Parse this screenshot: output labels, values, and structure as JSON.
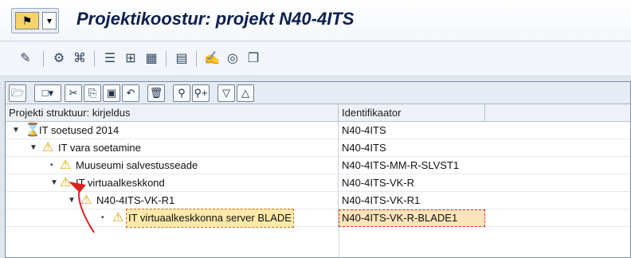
{
  "window": {
    "title": "Projektikoostur: projekt N40-4ITS",
    "system_menu_icon": "sap-menu-icon",
    "dropdown_icon": "chevron-down-icon"
  },
  "toolbar1": {
    "icons": [
      "wand-icon",
      "org-icon",
      "hierarchy-icon",
      "list-icon",
      "tree-icon",
      "grid-icon",
      "table-icon",
      "edit-icon",
      "cycle-icon",
      "notes-icon"
    ]
  },
  "toolbar2": {
    "icons": [
      "open-folder-icon",
      "new-doc-icon",
      "cut-icon",
      "copy-icon",
      "paste-icon",
      "undo-icon",
      "delete-icon",
      "find-icon",
      "find-next-icon",
      "expand-icon",
      "collapse-icon"
    ]
  },
  "table": {
    "headers": [
      "Projekti struktuur: kirjeldus",
      "Identifikaator"
    ],
    "rows": [
      {
        "desc": "IT soetused 2014",
        "id": "N40-4ITS",
        "level": 0,
        "icon": "project-icon",
        "expander": "▼"
      },
      {
        "desc": "IT vara soetamine",
        "id": "N40-4ITS",
        "level": 1,
        "icon": "warning-icon",
        "expander": "▼"
      },
      {
        "desc": "Muuseumi salvestusseade",
        "id": "N40-4ITS-MM-R-SLVST1",
        "level": 2,
        "icon": "warning-icon",
        "expander": "•"
      },
      {
        "desc": "IT virtuaalkeskkond",
        "id": "N40-4ITS-VK-R",
        "level": 2,
        "icon": "warning-icon",
        "expander": "▼"
      },
      {
        "desc": "N40-4ITS-VK-R1",
        "id": "N40-4ITS-VK-R1",
        "level": 3,
        "icon": "warning-icon",
        "expander": "▼"
      },
      {
        "desc": "IT virtuaalkeskkonna server BLADE",
        "id": "N40-4ITS-VK-R-BLADE1",
        "level": 4,
        "icon": "warning-icon",
        "expander": "•",
        "selected": true
      }
    ]
  },
  "colors": {
    "warning": "#d4a800",
    "annotation": "#e02020"
  }
}
